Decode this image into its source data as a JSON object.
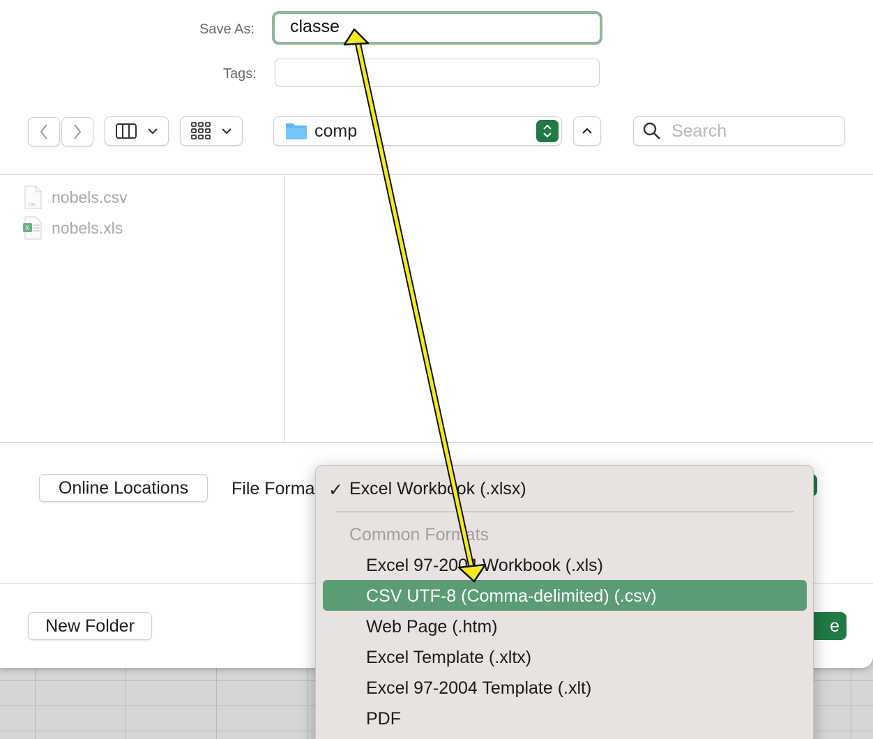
{
  "form": {
    "save_as_label": "Save As:",
    "save_as_value": "classe",
    "tags_label": "Tags:",
    "tags_value": ""
  },
  "toolbar": {
    "location": "comp",
    "search_placeholder": "Search"
  },
  "files": [
    {
      "name": "nobels.csv",
      "icon": "csv-file-icon"
    },
    {
      "name": "nobels.xls",
      "icon": "excel-file-icon"
    }
  ],
  "options": {
    "online_locations": "Online Locations",
    "file_format_label": "File Format:"
  },
  "footer": {
    "new_folder": "New Folder",
    "save_button_partial": "e"
  },
  "format_menu": {
    "selected": "Excel Workbook (.xlsx)",
    "checkmark": "✓",
    "group_label": "Common Formats",
    "items": [
      "Excel 97-2004 Workbook (.xls)",
      "CSV UTF-8 (Comma-delimited) (.csv)",
      "Web Page (.htm)",
      "Excel Template (.xltx)",
      "Excel 97-2004 Template (.xlt)",
      "PDF"
    ],
    "highlighted_index": 1
  },
  "colors": {
    "accent_green": "#1f7a44",
    "highlight_green": "#5b9c74",
    "focus_ring": "#8fb79a",
    "annotation_arrow": "#f2ea1c"
  }
}
